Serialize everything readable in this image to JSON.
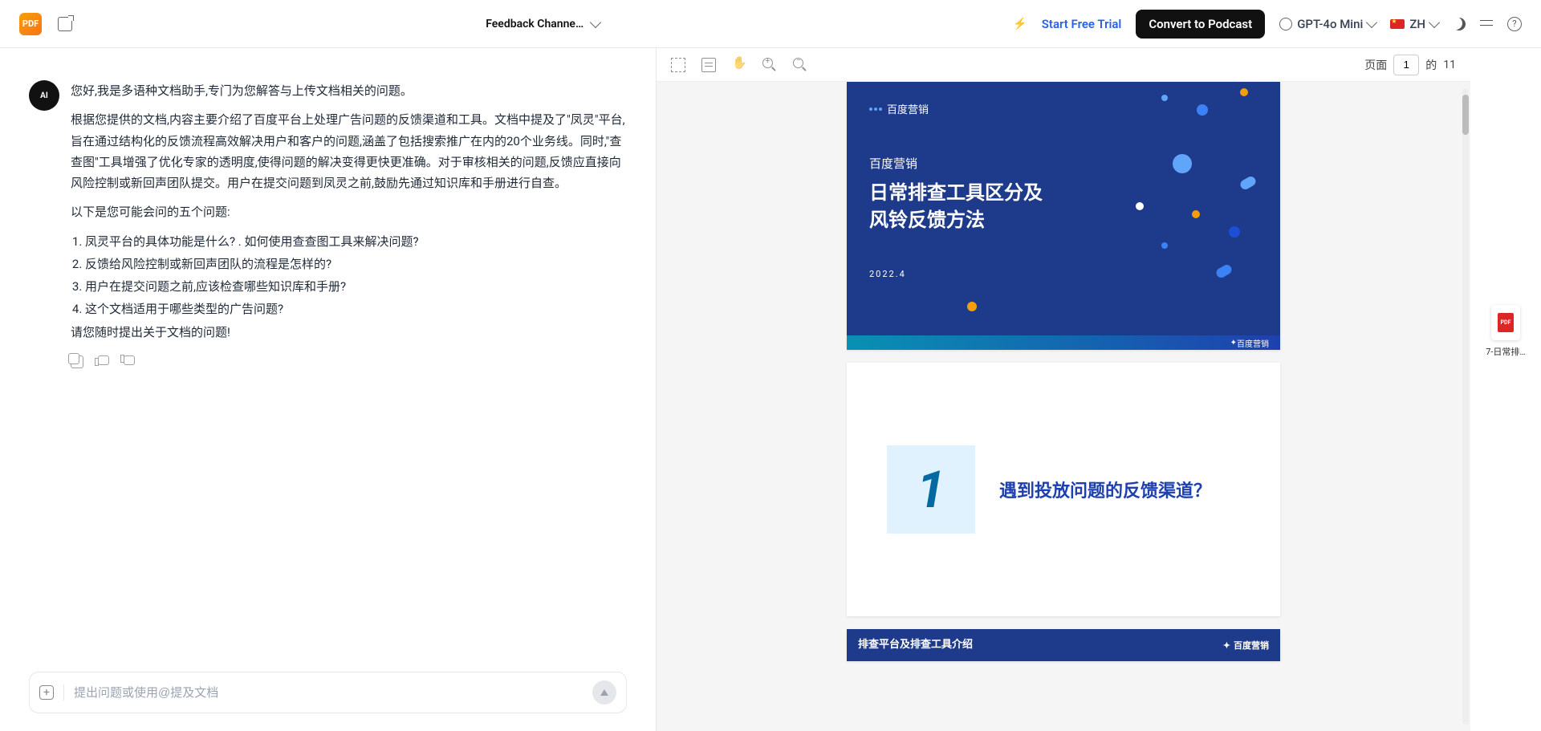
{
  "header": {
    "title": "Feedback Channe…",
    "start_trial": "Start Free Trial",
    "convert": "Convert to Podcast",
    "model": "GPT-4o Mini",
    "lang": "ZH"
  },
  "chat": {
    "greeting": "您好,我是多语种文档助手,专门为您解答与上传文档相关的问题。",
    "summary": "根据您提供的文档,内容主要介绍了百度平台上处理广告问题的反馈渠道和工具。文档中提及了\"凤灵\"平台,旨在通过结构化的反馈流程高效解决用户和客户的问题,涵盖了包括搜索推广在内的20个业务线。同时,\"查查图\"工具增强了优化专家的透明度,使得问题的解决变得更快更准确。对于审核相关的问题,反馈应直接向风险控制或新回声团队提交。用户在提交问题到凤灵之前,鼓励先通过知识库和手册进行自查。",
    "q_intro": "以下是您可能会问的五个问题:",
    "questions": [
      "凤灵平台的具体功能是什么? . 如何使用查查图工具来解决问题?",
      "反馈给风险控制或新回声团队的流程是怎样的?",
      "用户在提交问题之前,应该检查哪些知识库和手册?",
      "这个文档适用于哪些类型的广告问题?"
    ],
    "closing": "请您随时提出关于文档的问题!",
    "input_placeholder": "提出问题或使用@提及文档"
  },
  "pdf": {
    "toolbar": {
      "page_label": "页面",
      "current_page": "1",
      "of": "的",
      "total": "11"
    },
    "page1": {
      "brand": "百度营销",
      "sub": "百度营销",
      "line1": "日常排查工具区分及",
      "line2": "风铃反馈方法",
      "date": "2022.4",
      "footer_brand": "百度营销"
    },
    "page2": {
      "num": "1",
      "title": "遇到投放问题的反馈渠道？"
    },
    "page3": {
      "title": "排查平台及排查工具介绍",
      "brand": "百度营销"
    }
  },
  "sidebar": {
    "file_label": "7-日常排…"
  }
}
